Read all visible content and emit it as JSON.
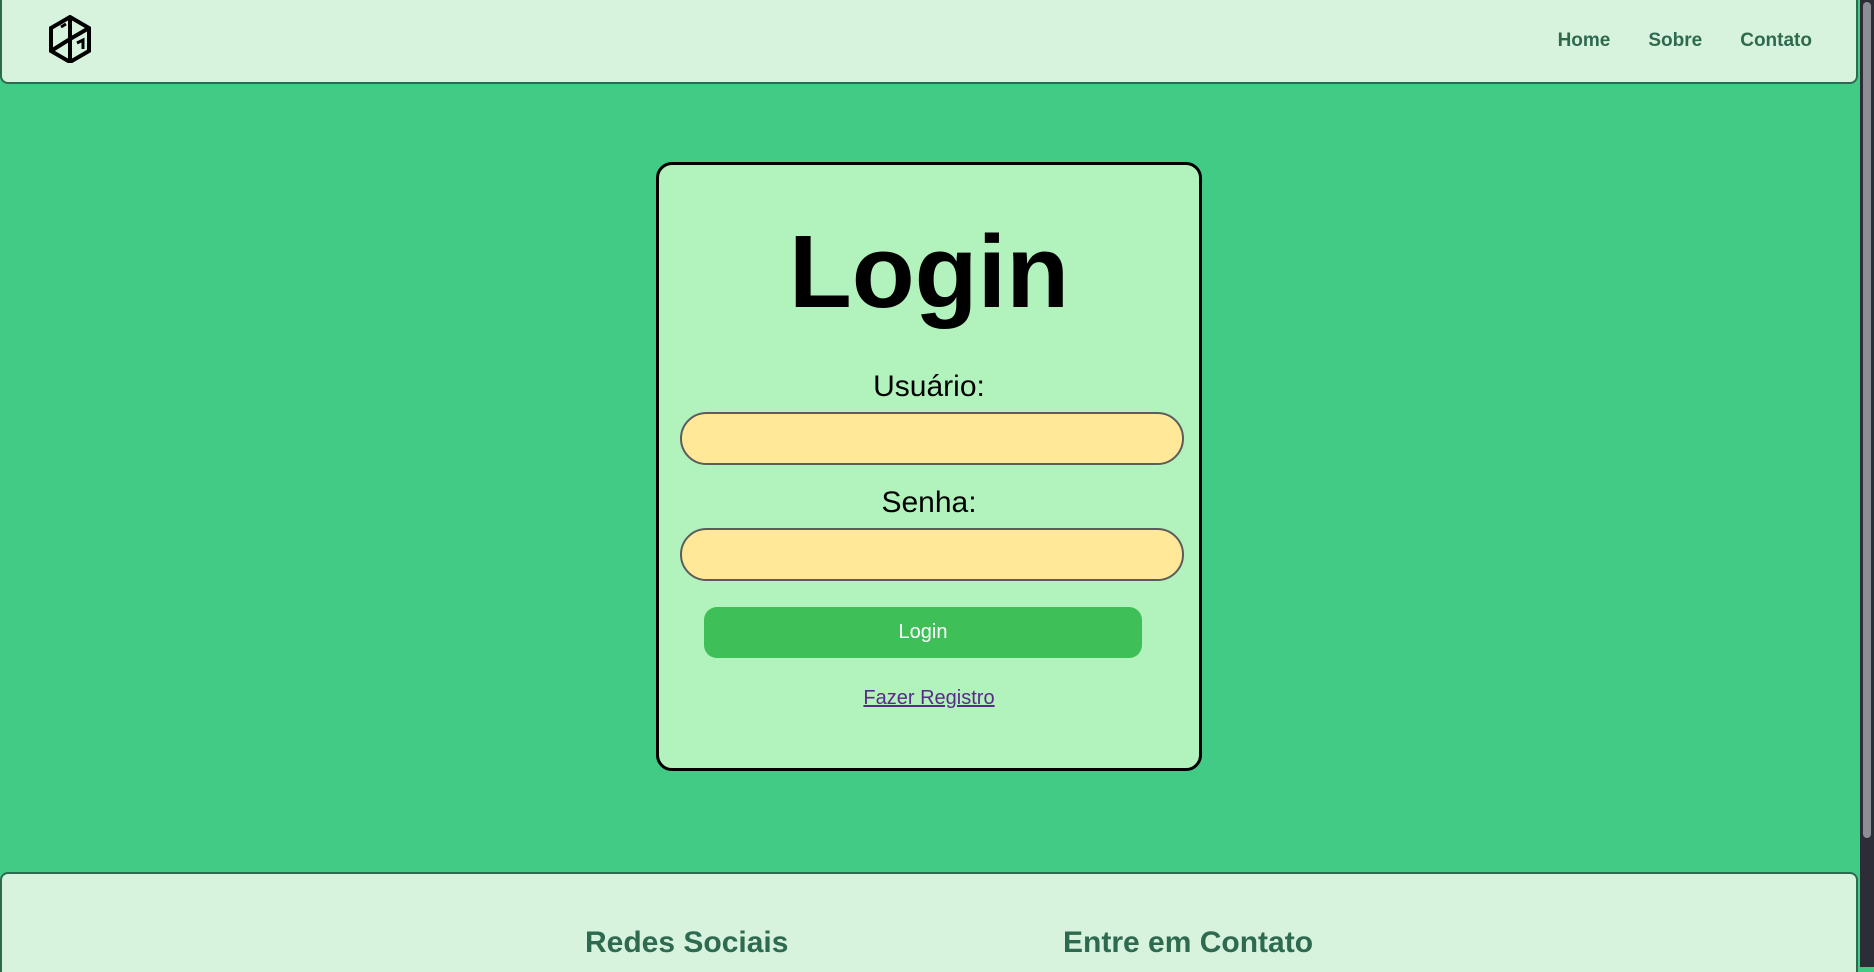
{
  "nav": {
    "logo_icon": "cube-logo-icon",
    "links": [
      "Home",
      "Sobre",
      "Contato"
    ]
  },
  "login": {
    "title": "Login",
    "username_label": "Usuário:",
    "username_value": "",
    "password_label": "Senha:",
    "password_value": "",
    "submit_label": "Login",
    "register_link": "Fazer Registro"
  },
  "footer": {
    "social_heading": "Redes Sociais",
    "contact_heading": "Entre em Contato"
  },
  "colors": {
    "background": "#42cb85",
    "nav_bg": "#d8f3dd",
    "card_bg": "#b2f2bc",
    "input_bg": "#ffe897",
    "button_bg": "#3fbf57",
    "text_green": "#2d6a4f"
  }
}
